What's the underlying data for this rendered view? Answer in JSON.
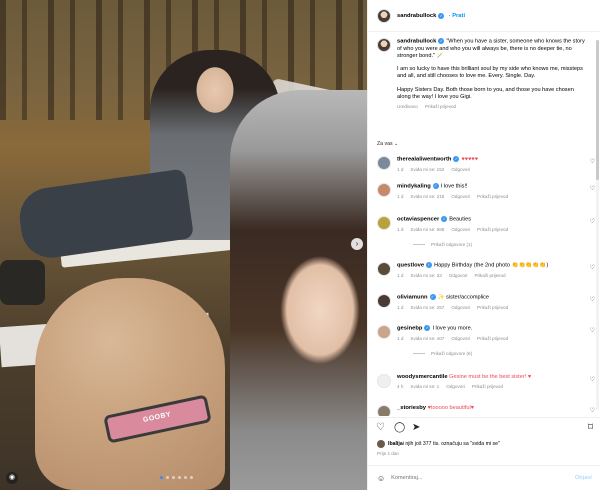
{
  "post": {
    "username": "sandrabullock",
    "follow_label": "Prati",
    "caption": "\"When you have a sister, someone who knows the story of who you were and who you will always be, there is no deeper tie, no stronger bond.\" 🪄",
    "caption_p2": "I am so lucky to have this brilliant soul by my side who knows me, missteps and all, and still chooses to love me. Every. Single. Day.",
    "caption_p3": "Happy Sisters Day. Both those born to you, and those you have chosen along the way! I love you Gigi.",
    "edited_label": "Uređivano",
    "edited_dot": "·",
    "see_translation": "Prikaži prijevod",
    "image_tag": "GOOBY",
    "carousel_current": 1,
    "carousel_total": 6
  },
  "section_label": "Za vas",
  "section_chevron": "⌄",
  "comments": [
    {
      "user": "therealaliwentworth",
      "verified": true,
      "text": "♥♥♥♥♥",
      "time": "1 d",
      "likes": "Sviđa mi se: 152",
      "reply": "Odgovori",
      "avatar_color": "#7a8a9a"
    },
    {
      "user": "mindykaling",
      "verified": true,
      "text": "I love this!!",
      "time": "1 d",
      "likes": "Sviđa mi se: 218",
      "reply": "Odgovori",
      "translate": "Prikaži prijevod",
      "avatar_color": "#c48a6a"
    },
    {
      "user": "octaviaspencer",
      "verified": true,
      "text": "Beauties",
      "time": "1 d",
      "likes": "Sviđa mi se: 588",
      "reply": "Odgovori",
      "translate": "Prikaži prijevod",
      "avatar_color": "#b8a23a",
      "replies": "Prikaži odgovore (1)"
    },
    {
      "user": "questlove",
      "verified": true,
      "text": "Happy Birthday (the 2nd photo 👏👏👏👏👏)",
      "time": "1 d",
      "likes": "Sviđa mi se: 33",
      "reply": "Odgovori",
      "translate": "Prikaži prijevod",
      "avatar_color": "#5a4a3a"
    },
    {
      "user": "oliviamunn",
      "verified": true,
      "text": "✨ sister/accomplice",
      "time": "1 d",
      "likes": "Sviđa mi se: 257",
      "reply": "Odgovori",
      "translate": "Prikaži prijevod",
      "avatar_color": "#4a3a34"
    },
    {
      "user": "gesinebp",
      "verified": true,
      "text": "I love you more.",
      "time": "1 d",
      "likes": "Sviđa mi se: 407",
      "reply": "Odgovori",
      "translate": "Prikaži prijevod",
      "avatar_color": "#c9a58c",
      "replies": "Prikaži odgovore (6)"
    },
    {
      "user": "woodysmercantile",
      "verified": false,
      "text": "Gesine must be the best sister! ♥",
      "time": "4 h",
      "likes": "Sviđa mi se: 1",
      "reply": "Odgovori",
      "translate": "Prikaži prijevod",
      "avatar_color": "#f0f0f0"
    },
    {
      "user": "_storiesby",
      "verified": false,
      "text": "♥tooooo beautiful♥",
      "time": "",
      "likes": "",
      "reply": "",
      "avatar_color": "#8a7a6a"
    }
  ],
  "actions": {
    "like_icon": "♡",
    "comment_icon": "◯",
    "share_icon": "➤",
    "save_icon": "⌑",
    "liked_by_prefix": "",
    "liked_by_user": "lbalija",
    "liked_by_rest": " i njih još 377 tis. označuju sa \"sviđa mi se\"",
    "time": "Prije 1 dan"
  },
  "composer": {
    "emoji_icon": "☺",
    "placeholder": "Komentiraj...",
    "post_label": "Objavi"
  },
  "photo_controls": {
    "next_icon": "›",
    "user_tag_icon": "◉"
  }
}
